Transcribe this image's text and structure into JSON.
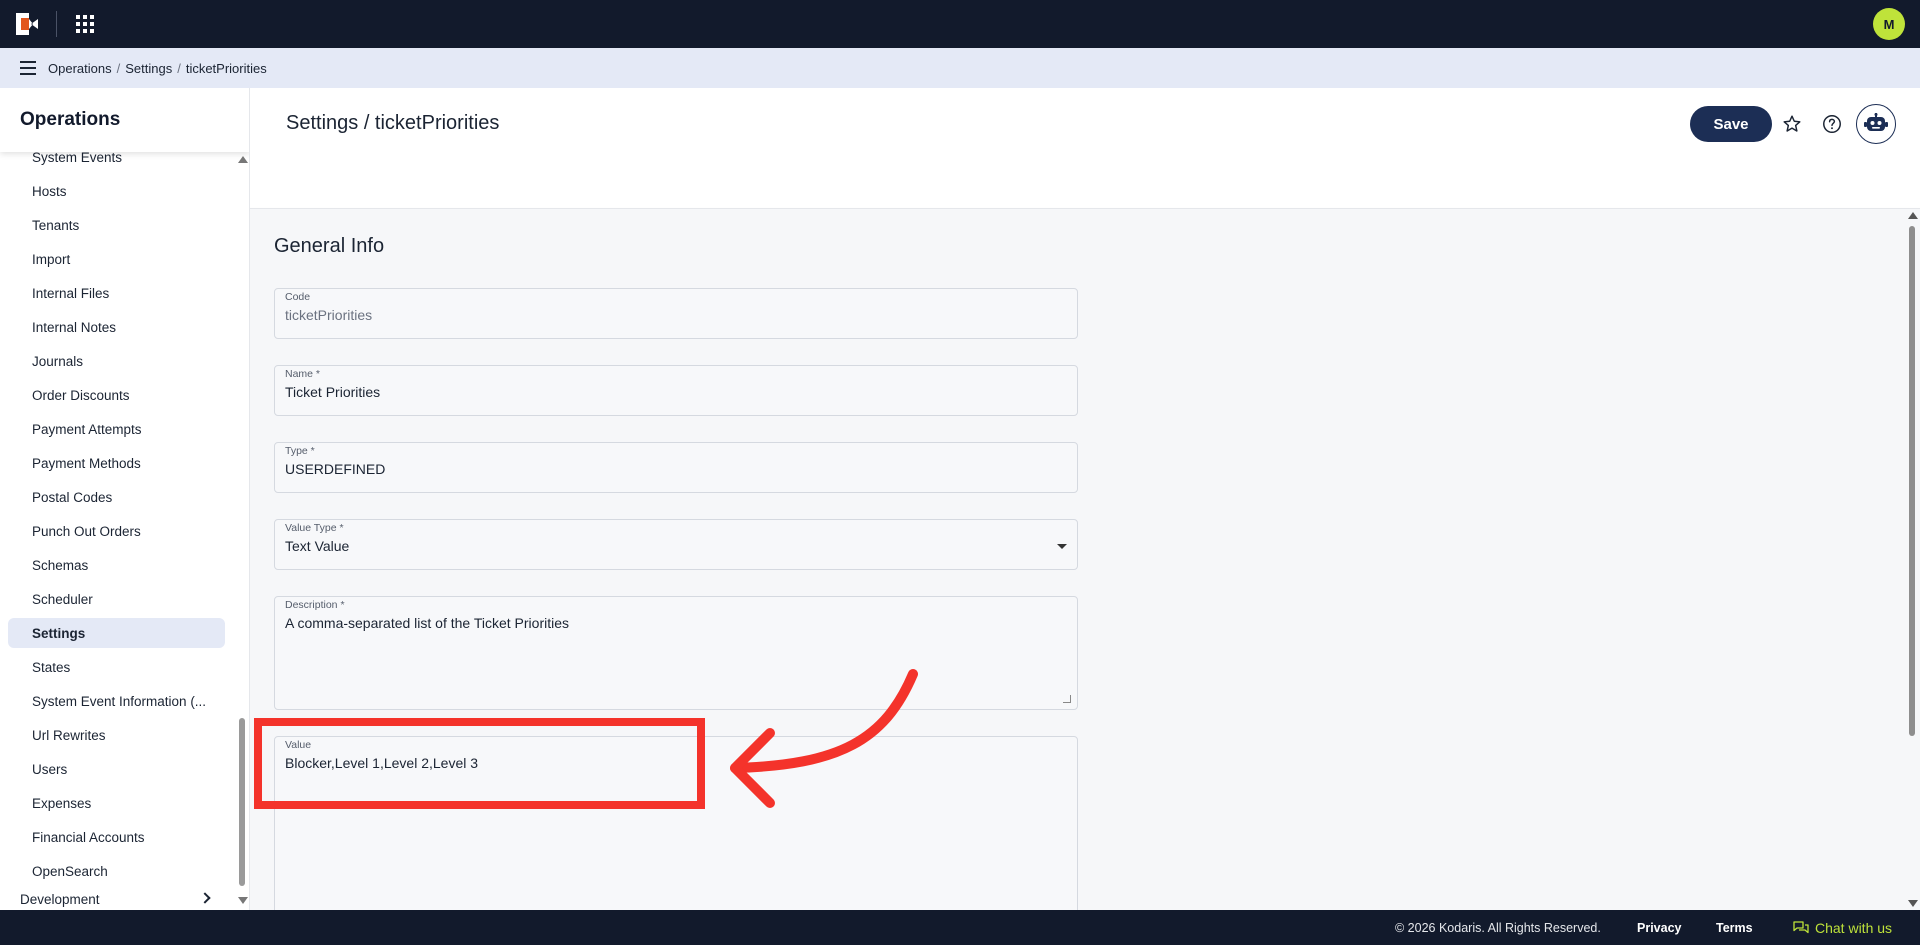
{
  "topbar": {
    "logo_icon": "kodaris-logo-icon",
    "apps_icon": "apps-grid-icon",
    "avatar_initial": "M",
    "avatar_color": "#bfe33a",
    "background": "#121a2c"
  },
  "breadcrumb": {
    "items": [
      "Operations",
      "Settings",
      "ticketPriorities"
    ],
    "separator": "/"
  },
  "sidebar": {
    "title": "Operations",
    "items": [
      {
        "label": "System Events",
        "active": false
      },
      {
        "label": "Hosts",
        "active": false
      },
      {
        "label": "Tenants",
        "active": false
      },
      {
        "label": "Import",
        "active": false
      },
      {
        "label": "Internal Files",
        "active": false
      },
      {
        "label": "Internal Notes",
        "active": false
      },
      {
        "label": "Journals",
        "active": false
      },
      {
        "label": "Order Discounts",
        "active": false
      },
      {
        "label": "Payment Attempts",
        "active": false
      },
      {
        "label": "Payment Methods",
        "active": false
      },
      {
        "label": "Postal Codes",
        "active": false
      },
      {
        "label": "Punch Out Orders",
        "active": false
      },
      {
        "label": "Schemas",
        "active": false
      },
      {
        "label": "Scheduler",
        "active": false
      },
      {
        "label": "Settings",
        "active": true
      },
      {
        "label": "States",
        "active": false
      },
      {
        "label": "System Event Information (...",
        "active": false
      },
      {
        "label": "Url Rewrites",
        "active": false
      },
      {
        "label": "Users",
        "active": false
      },
      {
        "label": "Expenses",
        "active": false
      },
      {
        "label": "Financial Accounts",
        "active": false
      },
      {
        "label": "OpenSearch",
        "active": false
      }
    ],
    "section_next": "Development"
  },
  "header": {
    "title": "Settings / ticketPriorities",
    "save_label": "Save",
    "accent_color": "#1c2e55"
  },
  "form": {
    "section_title": "General Info",
    "code": {
      "label": "Code",
      "value": "ticketPriorities"
    },
    "name": {
      "label": "Name *",
      "value": "Ticket Priorities"
    },
    "type": {
      "label": "Type *",
      "value": "USERDEFINED"
    },
    "value_type": {
      "label": "Value Type *",
      "value": "Text Value"
    },
    "description": {
      "label": "Description *",
      "value": "A comma-separated list of the Ticket Priorities"
    },
    "value": {
      "label": "Value",
      "value": "Blocker,Level 1,Level 2,Level 3"
    }
  },
  "annotation": {
    "color": "#f4332b"
  },
  "footer": {
    "copyright": "© 2026 Kodaris. All Rights Reserved.",
    "privacy": "Privacy",
    "terms": "Terms",
    "chat": "Chat with us",
    "chat_color": "#bfe33a"
  }
}
